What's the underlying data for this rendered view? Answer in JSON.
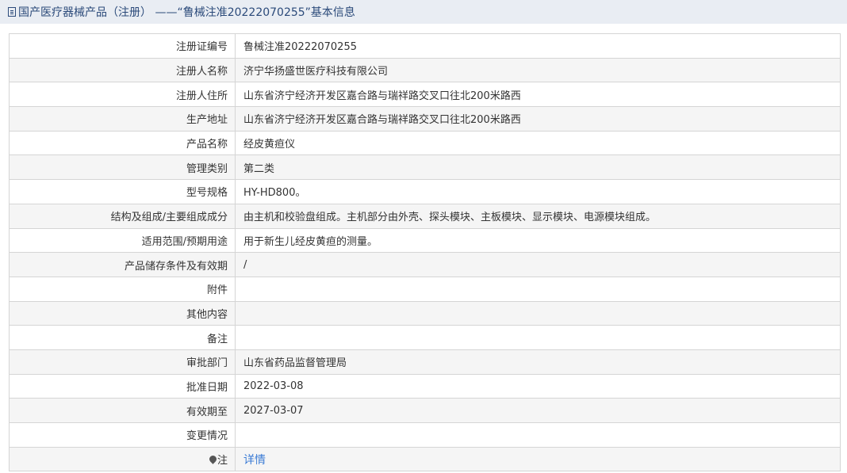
{
  "header": {
    "title": "国产医疗器械产品（注册） ——“鲁械注准20222070255”基本信息"
  },
  "fields": [
    {
      "label": "注册证编号",
      "value": "鲁械注准20222070255"
    },
    {
      "label": "注册人名称",
      "value": "济宁华扬盛世医疗科技有限公司"
    },
    {
      "label": "注册人住所",
      "value": "山东省济宁经济开发区嘉合路与瑞祥路交叉口往北200米路西"
    },
    {
      "label": "生产地址",
      "value": "山东省济宁经济开发区嘉合路与瑞祥路交叉口往北200米路西"
    },
    {
      "label": "产品名称",
      "value": "经皮黄疸仪"
    },
    {
      "label": "管理类别",
      "value": "第二类"
    },
    {
      "label": "型号规格",
      "value": "HY-HD800。"
    },
    {
      "label": "结构及组成/主要组成成分",
      "value": "由主机和校验盘组成。主机部分由外壳、探头模块、主板模块、显示模块、电源模块组成。"
    },
    {
      "label": "适用范围/预期用途",
      "value": "用于新生儿经皮黄疸的测量。"
    },
    {
      "label": "产品储存条件及有效期",
      "value": "/"
    },
    {
      "label": "附件",
      "value": ""
    },
    {
      "label": "其他内容",
      "value": ""
    },
    {
      "label": "备注",
      "value": ""
    },
    {
      "label": "审批部门",
      "value": "山东省药品监督管理局"
    },
    {
      "label": "批准日期",
      "value": "2022-03-08"
    },
    {
      "label": "有效期至",
      "value": "2027-03-07"
    },
    {
      "label": "变更情况",
      "value": ""
    }
  ],
  "note": {
    "label": "注",
    "link_text": "详情",
    "icon": "pin-icon"
  },
  "colors": {
    "header_bg": "#e9edf3",
    "header_text": "#2b4a7a",
    "row_alt": "#f5f5f5",
    "border": "#d5d5d5",
    "link": "#3a7bd5"
  }
}
